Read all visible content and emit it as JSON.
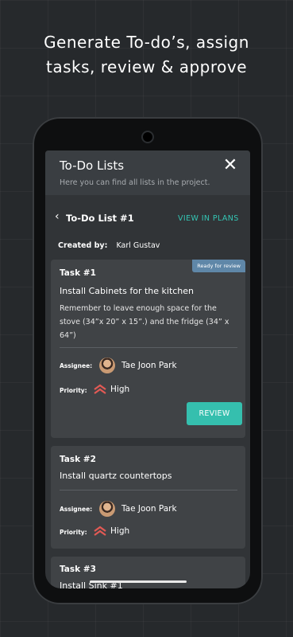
{
  "promo": {
    "line1": "Generate To-do’s, assign",
    "line2": "tasks, review & approve"
  },
  "modal": {
    "title": "To-Do Lists",
    "subtitle": "Here you can find all lists in the project.",
    "close_icon": "close-icon"
  },
  "list": {
    "back_icon": "chevron-left-icon",
    "title": "To-Do List #1",
    "view_plans": "VIEW IN PLANS",
    "created_label": "Created by:",
    "created_by": "Karl Gustav"
  },
  "labels": {
    "assignee": "Assignee:",
    "priority": "Priority:"
  },
  "tasks": [
    {
      "number": "Task #1",
      "badge": "Ready for review",
      "title": "Install Cabinets for the kitchen",
      "note": "Remember to leave enough space for the stove (34”x 20” x 15”.) and the fridge (34” x 64”)",
      "assignee": "Tae Joon Park",
      "priority": "High",
      "action": "REVIEW"
    },
    {
      "number": "Task #2",
      "title": "Install quartz countertops",
      "assignee": "Tae Joon Park",
      "priority": "High"
    },
    {
      "number": "Task #3",
      "title": "Install Sink #1"
    }
  ],
  "colors": {
    "accent": "#35bfae",
    "priority_high": "#e25a55",
    "badge": "#5f87a8"
  }
}
